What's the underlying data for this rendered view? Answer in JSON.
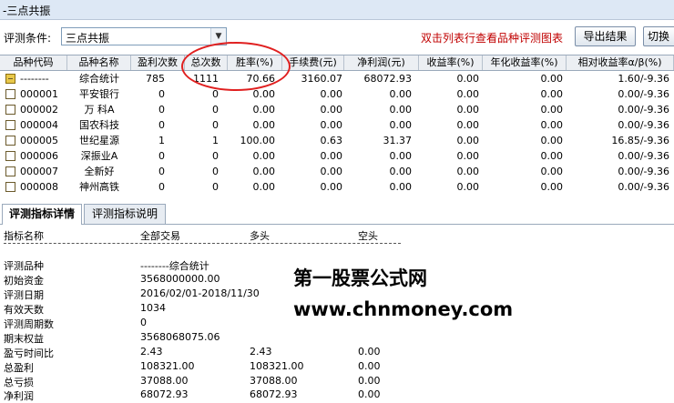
{
  "window": {
    "title": "-三点共振"
  },
  "toolbar": {
    "cond_label": "评测条件:",
    "select_value": "三点共振",
    "hint": "双击列表行查看品种评测图表",
    "export_label": "导出结果",
    "switch_label": "切换"
  },
  "grid": {
    "headers": [
      "品种代码",
      "品种名称",
      "盈利次数",
      "总次数",
      "胜率(%)",
      "手续费(元)",
      "净利润(元)",
      "收益率(%)",
      "年化收益率(%)",
      "相对收益率α/β(%)"
    ],
    "rows": [
      [
        "--------",
        "综合统计",
        "785",
        "1111",
        "70.66",
        "3160.07",
        "68072.93",
        "0.00",
        "0.00",
        "1.60/-9.36"
      ],
      [
        "000001",
        "平安银行",
        "0",
        "0",
        "0.00",
        "0.00",
        "0.00",
        "0.00",
        "0.00",
        "0.00/-9.36"
      ],
      [
        "000002",
        "万 科A",
        "0",
        "0",
        "0.00",
        "0.00",
        "0.00",
        "0.00",
        "0.00",
        "0.00/-9.36"
      ],
      [
        "000004",
        "国农科技",
        "0",
        "0",
        "0.00",
        "0.00",
        "0.00",
        "0.00",
        "0.00",
        "0.00/-9.36"
      ],
      [
        "000005",
        "世纪星源",
        "1",
        "1",
        "100.00",
        "0.63",
        "31.37",
        "0.00",
        "0.00",
        "16.85/-9.36"
      ],
      [
        "000006",
        "深振业A",
        "0",
        "0",
        "0.00",
        "0.00",
        "0.00",
        "0.00",
        "0.00",
        "0.00/-9.36"
      ],
      [
        "000007",
        "全新好",
        "0",
        "0",
        "0.00",
        "0.00",
        "0.00",
        "0.00",
        "0.00",
        "0.00/-9.36"
      ],
      [
        "000008",
        "神州高铁",
        "0",
        "0",
        "0.00",
        "0.00",
        "0.00",
        "0.00",
        "0.00",
        "0.00/-9.36"
      ]
    ]
  },
  "tabs": [
    "评测指标详情",
    "评测指标说明"
  ],
  "detail": {
    "col_headers": [
      "指标名称",
      "全部交易",
      "多头",
      "空头"
    ],
    "rows": [
      [
        "评测品种",
        "--------综合统计",
        "",
        ""
      ],
      [
        "初始资金",
        "3568000000.00",
        "",
        ""
      ],
      [
        "评测日期",
        "2016/02/01-2018/11/30",
        "",
        ""
      ],
      [
        "有效天数",
        "1034",
        "",
        ""
      ],
      [
        "评测周期数",
        "0",
        "",
        ""
      ],
      [
        "期末权益",
        "3568068075.06",
        "",
        ""
      ],
      [
        "盈亏时间比",
        "2.43",
        "2.43",
        "0.00"
      ],
      [
        "总盈利",
        "108321.00",
        "108321.00",
        "0.00"
      ],
      [
        "总亏损",
        "37088.00",
        "37088.00",
        "0.00"
      ],
      [
        "净利润",
        "68072.93",
        "68072.93",
        "0.00"
      ]
    ]
  },
  "watermark": {
    "line1": "第一股票公式网",
    "line2": "www.chnmoney.com"
  },
  "colors": {
    "hint": "#c00000",
    "annotation_circle": "#e02020",
    "summary_icon": "#e8c84a"
  }
}
